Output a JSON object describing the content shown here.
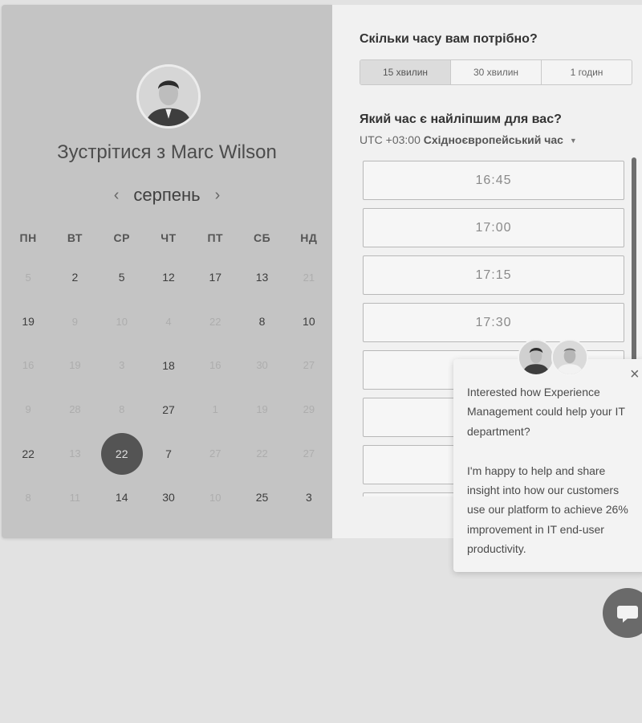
{
  "scheduler": {
    "host_prefix": "Зустрітися з",
    "host_name": "Marc Wilson",
    "month": "серпень",
    "prev_arrow": "‹",
    "next_arrow": "›",
    "weekdays": [
      "ПН",
      "ВТ",
      "СР",
      "ЧТ",
      "ПТ",
      "СБ",
      "НД"
    ],
    "days": [
      {
        "label": "5",
        "state": "muted"
      },
      {
        "label": "2",
        "state": "available"
      },
      {
        "label": "5",
        "state": "available"
      },
      {
        "label": "12",
        "state": "available"
      },
      {
        "label": "17",
        "state": "available"
      },
      {
        "label": "13",
        "state": "available"
      },
      {
        "label": "21",
        "state": "muted"
      },
      {
        "label": "19",
        "state": "available"
      },
      {
        "label": "9",
        "state": "muted"
      },
      {
        "label": "10",
        "state": "muted"
      },
      {
        "label": "4",
        "state": "muted"
      },
      {
        "label": "22",
        "state": "muted"
      },
      {
        "label": "8",
        "state": "available"
      },
      {
        "label": "10",
        "state": "available"
      },
      {
        "label": "16",
        "state": "muted"
      },
      {
        "label": "19",
        "state": "muted"
      },
      {
        "label": "3",
        "state": "muted"
      },
      {
        "label": "18",
        "state": "available"
      },
      {
        "label": "16",
        "state": "muted"
      },
      {
        "label": "30",
        "state": "muted"
      },
      {
        "label": "27",
        "state": "muted"
      },
      {
        "label": "9",
        "state": "muted"
      },
      {
        "label": "28",
        "state": "muted"
      },
      {
        "label": "8",
        "state": "muted"
      },
      {
        "label": "27",
        "state": "available"
      },
      {
        "label": "1",
        "state": "muted"
      },
      {
        "label": "19",
        "state": "muted"
      },
      {
        "label": "29",
        "state": "muted"
      },
      {
        "label": "22",
        "state": "available"
      },
      {
        "label": "13",
        "state": "muted"
      },
      {
        "label": "22",
        "state": "selected"
      },
      {
        "label": "7",
        "state": "available"
      },
      {
        "label": "27",
        "state": "muted"
      },
      {
        "label": "22",
        "state": "muted"
      },
      {
        "label": "27",
        "state": "muted"
      },
      {
        "label": "8",
        "state": "muted"
      },
      {
        "label": "11",
        "state": "muted"
      },
      {
        "label": "14",
        "state": "available"
      },
      {
        "label": "30",
        "state": "available"
      },
      {
        "label": "10",
        "state": "muted"
      },
      {
        "label": "25",
        "state": "available"
      },
      {
        "label": "3",
        "state": "available"
      }
    ]
  },
  "duration": {
    "heading": "Скільки часу вам потрібно?",
    "options": [
      "15 хвилин",
      "30 хвилин",
      "1 годин"
    ],
    "selected_index": 0
  },
  "timeslots": {
    "heading": "Який час є найліпшим для вас?",
    "tz_offset": "UTC +03:00",
    "tz_name": "Східноєвропейський час",
    "slots": [
      "16:45",
      "17:00",
      "17:15",
      "17:30",
      "",
      "",
      "",
      ""
    ]
  },
  "chat": {
    "message": "Interested how Experience Management could help your IT department?\n\nI'm happy to help and share insight into how our customers use our platform to achieve 26% improvement in IT end-user productivity.",
    "close_glyph": "×"
  },
  "colors": {
    "left_panel_bg": "#c4c4c4",
    "right_panel_bg": "#f1f1f1",
    "selected_day_bg": "#545454",
    "page_bg": "#e2e2e2"
  }
}
